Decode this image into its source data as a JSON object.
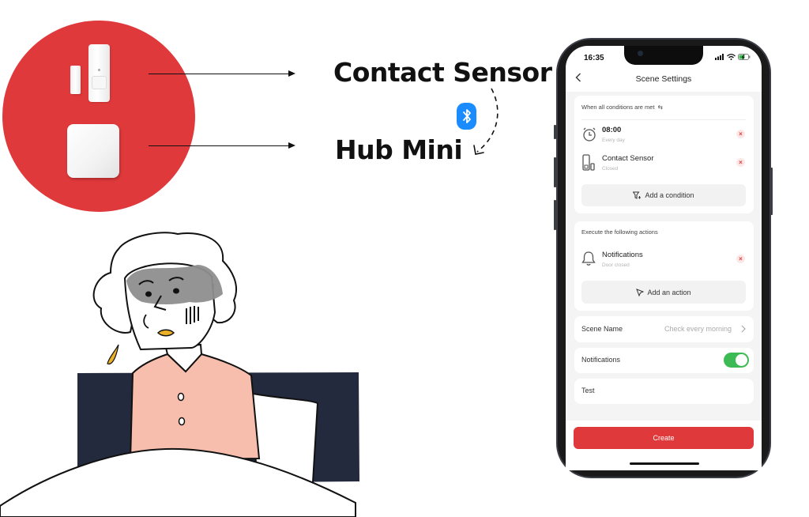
{
  "illustration": {
    "labels": {
      "contact_sensor": "Contact Sensor",
      "hub_mini": "Hub Mini"
    },
    "colors": {
      "circle_red": "#e0393b",
      "bluetooth_blue": "#1a8cff",
      "bed_navy": "#232a3d",
      "shirt_pink": "#f7beae",
      "hair_gray": "#8e8e8e",
      "accent_yellow": "#e9b128"
    },
    "icons": {
      "bluetooth": "bluetooth-icon",
      "dashed_arrow": "curved-dashed-arrow-icon"
    }
  },
  "phone": {
    "status_bar": {
      "time": "16:35",
      "icons": [
        "signal-icon",
        "wifi-icon",
        "battery-charging-icon"
      ]
    },
    "header": {
      "back": "<",
      "title": "Scene Settings"
    },
    "conditions": {
      "label": "When all conditions are met",
      "toggle_glyph": "⇆",
      "items": [
        {
          "icon": "clock-icon",
          "title": "08:00",
          "subtitle": "Every day"
        },
        {
          "icon": "contact-sensor-icon",
          "title": "Contact Sensor",
          "subtitle": "Closed"
        }
      ],
      "add_label": "Add a condition"
    },
    "actions": {
      "label": "Execute the following actions",
      "items": [
        {
          "icon": "bell-icon",
          "title": "Notifications",
          "subtitle": "Door closed"
        }
      ],
      "add_label": "Add an action"
    },
    "settings": {
      "scene_name_label": "Scene Name",
      "scene_name_value": "Check every morning",
      "notifications_label": "Notifications",
      "notifications_enabled": true,
      "test_label": "Test"
    },
    "create_label": "Create",
    "colors": {
      "primary_red": "#e0393b",
      "toggle_green": "#3cba54"
    }
  }
}
